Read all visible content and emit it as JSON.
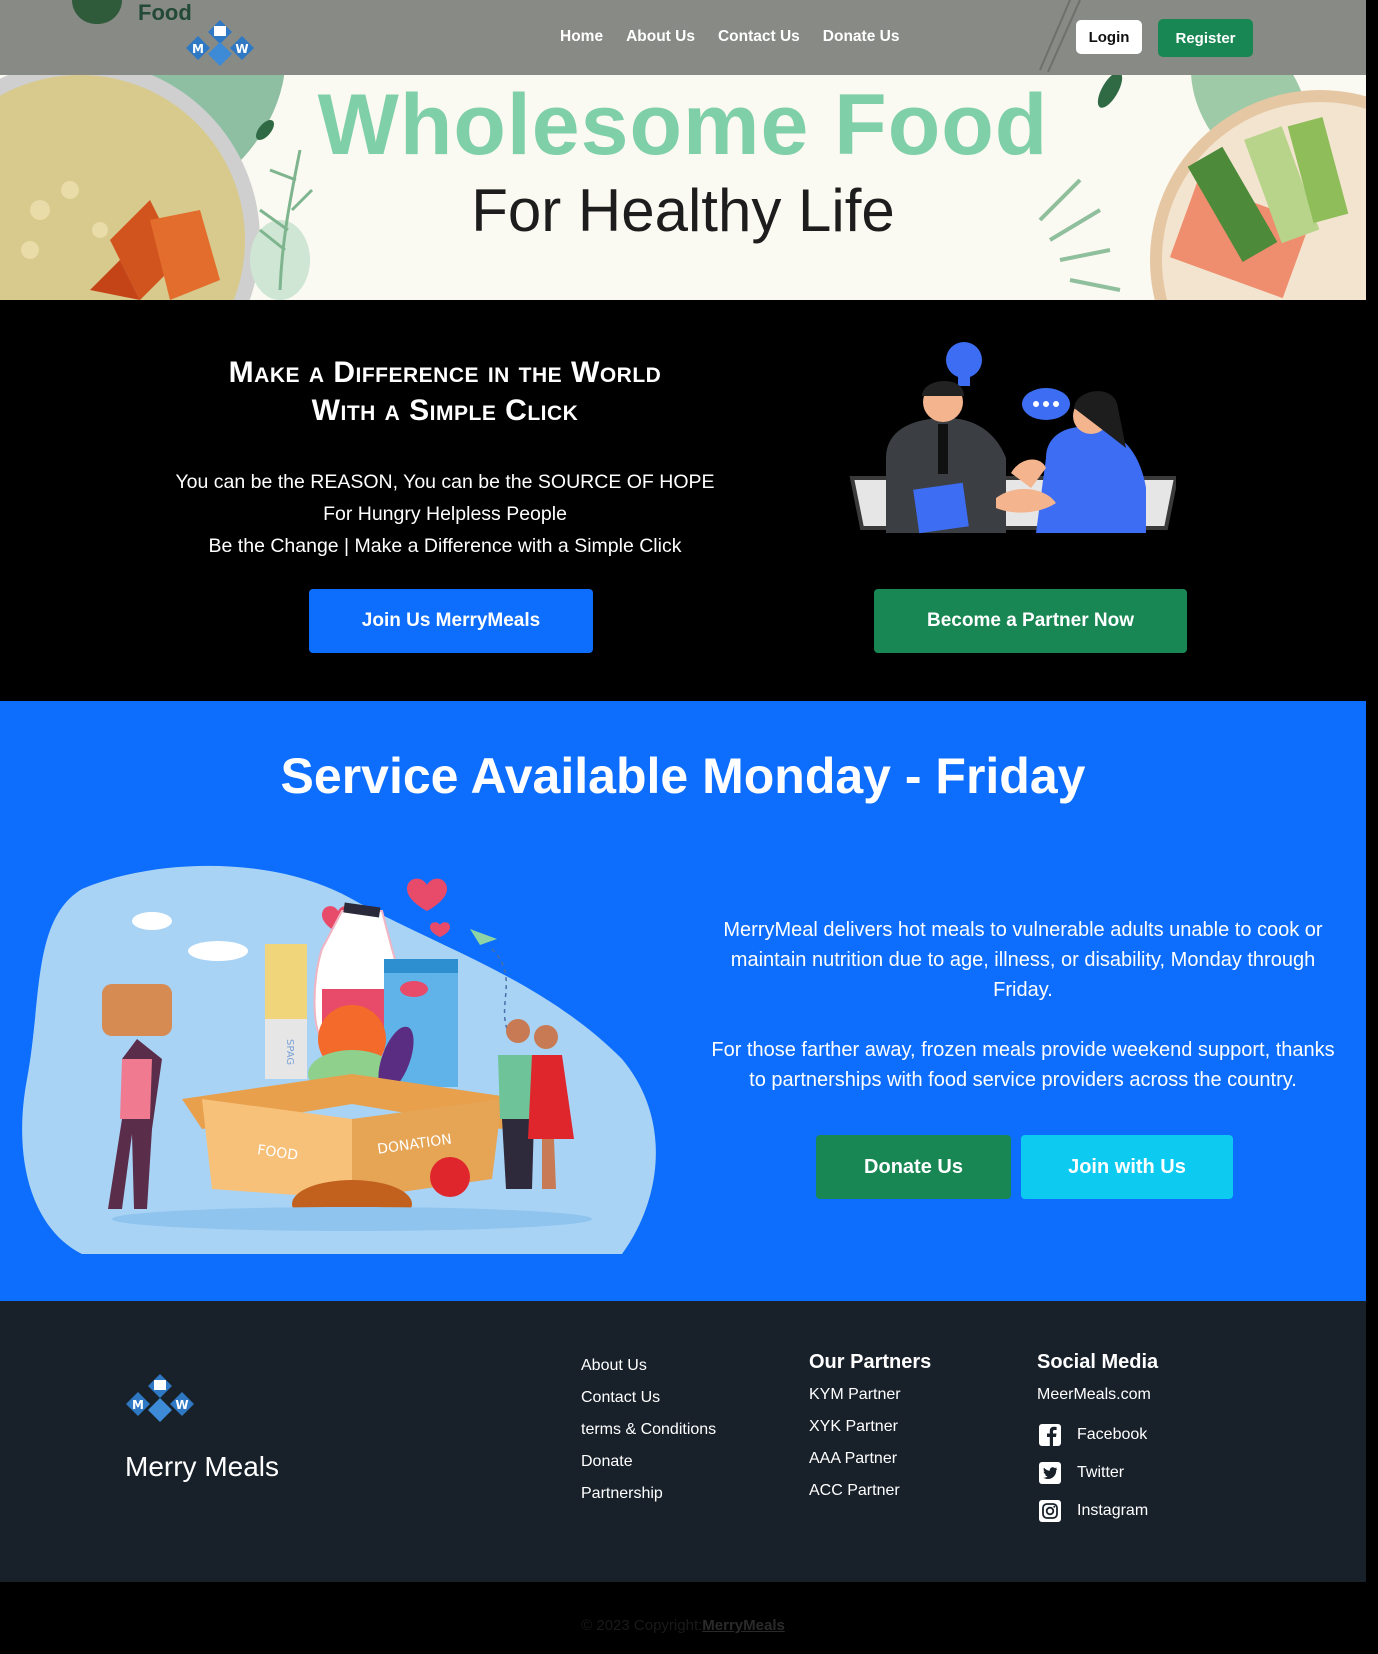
{
  "nav": {
    "brand_text": "Food",
    "links": [
      "Home",
      "About Us",
      "Contact Us",
      "Donate Us"
    ],
    "login_label": "Login",
    "register_label": "Register"
  },
  "hero": {
    "title": "Wholesome Food",
    "subtitle": "For Healthy Life"
  },
  "difference": {
    "heading_line1": "Make a Difference in the World",
    "heading_line2": "With a Simple Click",
    "line1": "You can be the REASON, You can be the SOURCE OF HOPE",
    "line2": "For Hungry Helpless People",
    "line3": "Be the Change | Make a Difference with a Simple Click",
    "join_button": "Join Us MerryMeals",
    "partner_button": "Become a Partner Now"
  },
  "service": {
    "title": "Service Available Monday - Friday",
    "paragraph1": "MerryMeal delivers hot meals to vulnerable adults unable to cook or maintain nutrition due to age, illness, or disability, Monday through Friday.",
    "paragraph2": "For those farther away, frozen meals provide weekend support, thanks to partnerships with food service providers across the country.",
    "donate_button": "Donate Us",
    "join_button": "Join with Us",
    "box_label_left": "FOOD",
    "box_label_right": "DONATION",
    "pasta_label": "SPAG"
  },
  "footer": {
    "brand": "Merry Meals",
    "links": [
      "About Us",
      "Contact Us",
      "terms & Conditions",
      "Donate",
      "Partnership"
    ],
    "partners_title": "Our Partners",
    "partners": [
      "KYM Partner",
      "XYK Partner",
      "AAA Partner",
      "ACC Partner"
    ],
    "social_title": "Social Media",
    "site": "MeerMeals.com",
    "social": [
      {
        "label": "Facebook",
        "icon": "facebook-icon"
      },
      {
        "label": "Twitter",
        "icon": "twitter-icon"
      },
      {
        "label": "Instagram",
        "icon": "instagram-icon"
      }
    ]
  },
  "copyright": {
    "text": "© 2023 Copyright:",
    "link": "MerryMeals"
  },
  "colors": {
    "primary": "#0d6efd",
    "success": "#198754",
    "info": "#0dcaf0",
    "hero_title": "#7fcfa8",
    "footer_bg": "#18202a"
  }
}
